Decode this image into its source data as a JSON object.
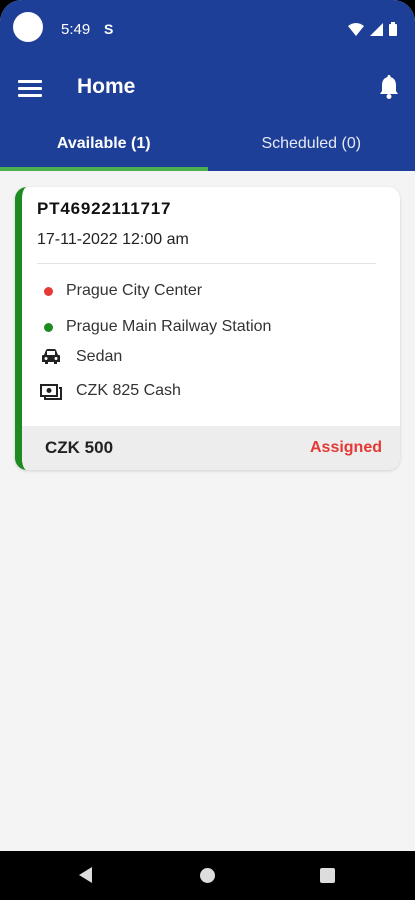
{
  "status_bar": {
    "time": "5:49",
    "notif_glyph": "S",
    "icons": [
      "wifi-icon",
      "signal-icon",
      "battery-icon"
    ]
  },
  "header": {
    "title": "Home",
    "menu_icon": "hamburger-menu-icon",
    "bell_icon": "bell-icon"
  },
  "tabs": [
    {
      "label": "Available (1)",
      "active": true
    },
    {
      "label": "Scheduled (0)",
      "active": false
    }
  ],
  "booking": {
    "id": "PT46922111717",
    "datetime": "17-11-2022 12:00 am",
    "pickup": "Prague City Center",
    "dropoff": "Prague Main Railway Station",
    "vehicle": "Sedan",
    "payment": "CZK 825 Cash",
    "price": "CZK 500",
    "status": "Assigned"
  },
  "colors": {
    "appbar": "#1e3f97",
    "tab_indicator": "#4caf50",
    "card_accent": "#1e8a22",
    "pickup_dot": "#e53935",
    "dropoff_dot": "#1e8a22",
    "status_text": "#e53935"
  },
  "nav_icons": [
    "back-icon",
    "home-icon",
    "recents-icon"
  ]
}
